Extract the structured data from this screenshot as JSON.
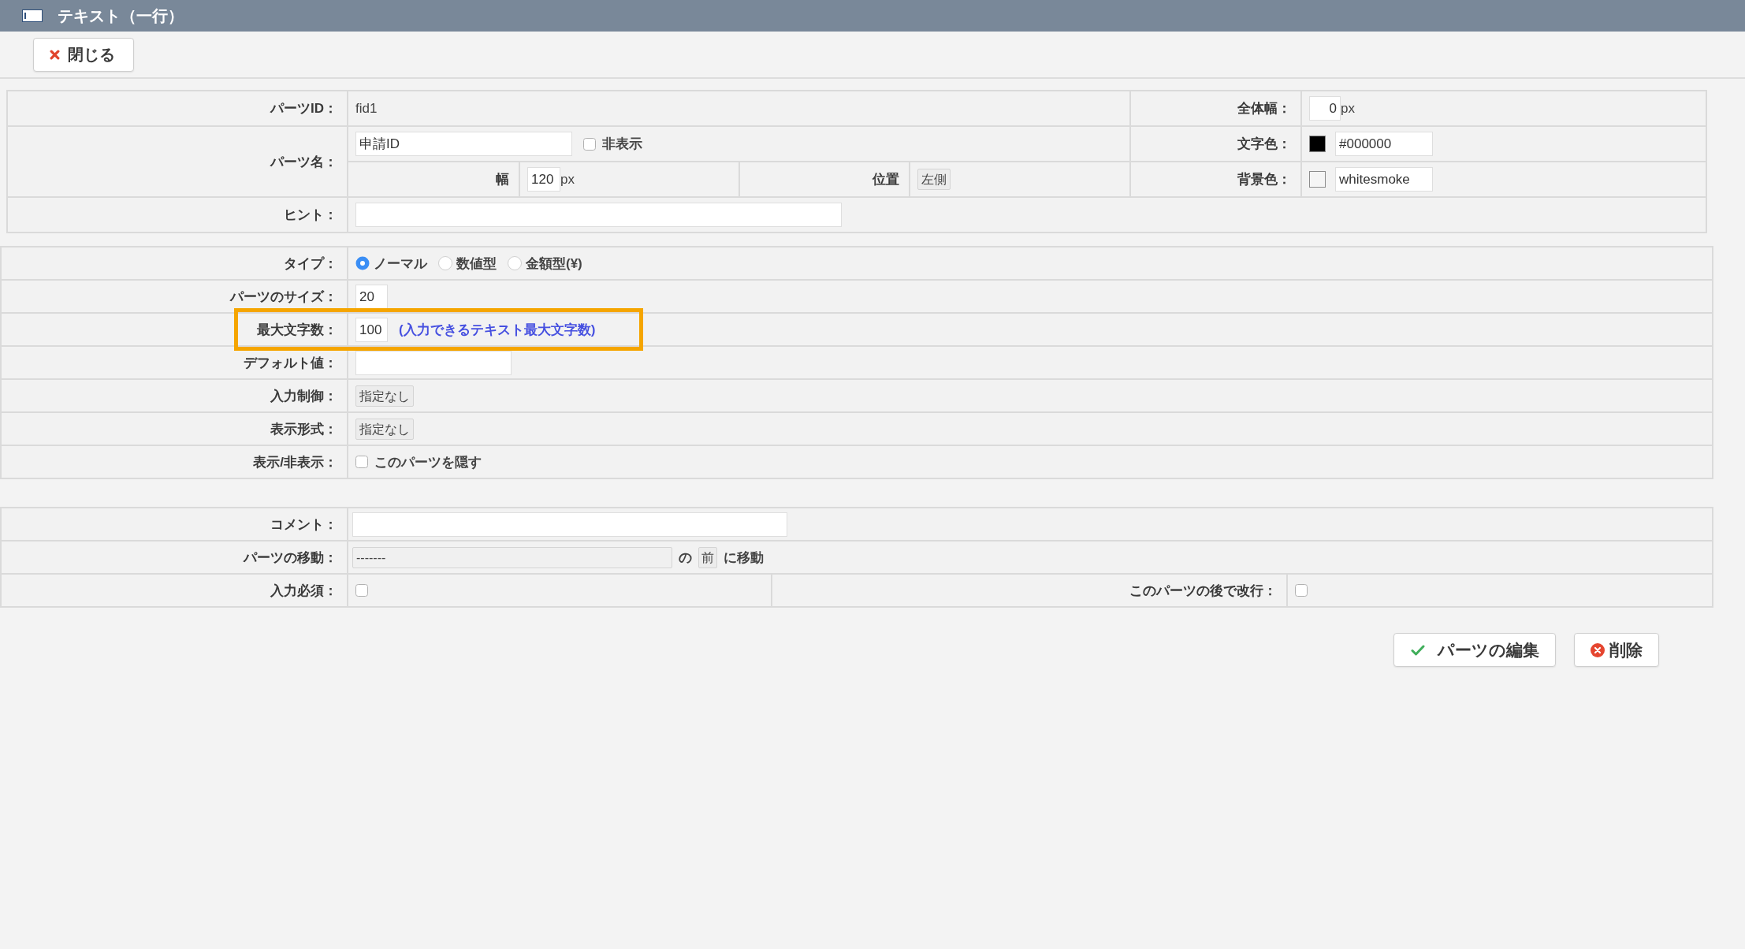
{
  "window": {
    "title": "テキスト（一行）"
  },
  "toolbar": {
    "close_button": "閉じる"
  },
  "basic": {
    "parts_id": {
      "label": "パーツID：",
      "value": "fid1"
    },
    "total_width": {
      "label": "全体幅：",
      "value": "0",
      "unit": "px"
    },
    "parts_name": {
      "label": "パーツ名：",
      "value": "申請ID",
      "hidden": {
        "label": "非表示",
        "checked": false
      }
    },
    "text_color": {
      "label": "文字色：",
      "color": "#000000",
      "value": "#000000"
    },
    "width": {
      "label": "幅",
      "value": "120",
      "unit": "px"
    },
    "position": {
      "label": "位置",
      "value": "左側"
    },
    "background_color": {
      "label": "背景色：",
      "color": "#f5f5f5",
      "value": "whitesmoke"
    },
    "hint": {
      "label": "ヒント："
    }
  },
  "settings": {
    "rows": [
      {
        "kind": "radio",
        "label": "タイプ：",
        "highlighted": false,
        "options": [
          {
            "label": "ノーマル",
            "selected": true
          },
          {
            "label": "数値型",
            "selected": false
          },
          {
            "label": "金額型(¥)",
            "selected": false
          }
        ]
      },
      {
        "kind": "text",
        "label": "パーツのサイズ：",
        "highlighted": false,
        "value": "20"
      },
      {
        "kind": "text",
        "label": "最大文字数：",
        "highlighted": true,
        "value": "100",
        "note": "(入力できるテキスト最大文字数)"
      },
      {
        "kind": "text",
        "label": "デフォルト値：",
        "highlighted": false
      },
      {
        "kind": "select",
        "label": "入力制御：",
        "highlighted": false,
        "value": "指定なし"
      },
      {
        "kind": "select",
        "label": "表示形式：",
        "highlighted": false,
        "value": "指定なし"
      },
      {
        "kind": "checkbox",
        "label": "表示/非表示：",
        "highlighted": false,
        "option": {
          "label": "このパーツを隠す",
          "checked": false
        }
      }
    ]
  },
  "extra": {
    "rows": [
      {
        "kind": "text",
        "label": "コメント："
      },
      {
        "kind": "move",
        "label": "パーツの移動：",
        "target": "-------",
        "connector": "の",
        "position": "前",
        "suffix": "に移動"
      },
      {
        "kind": "checks",
        "label": "入力必須：",
        "checked": false,
        "second_label": "このパーツの後で改行：",
        "second_checked": false
      }
    ]
  },
  "actions": [
    {
      "kind": "edit",
      "label": "パーツの編集"
    },
    {
      "kind": "delete",
      "label": "削除"
    }
  ]
}
